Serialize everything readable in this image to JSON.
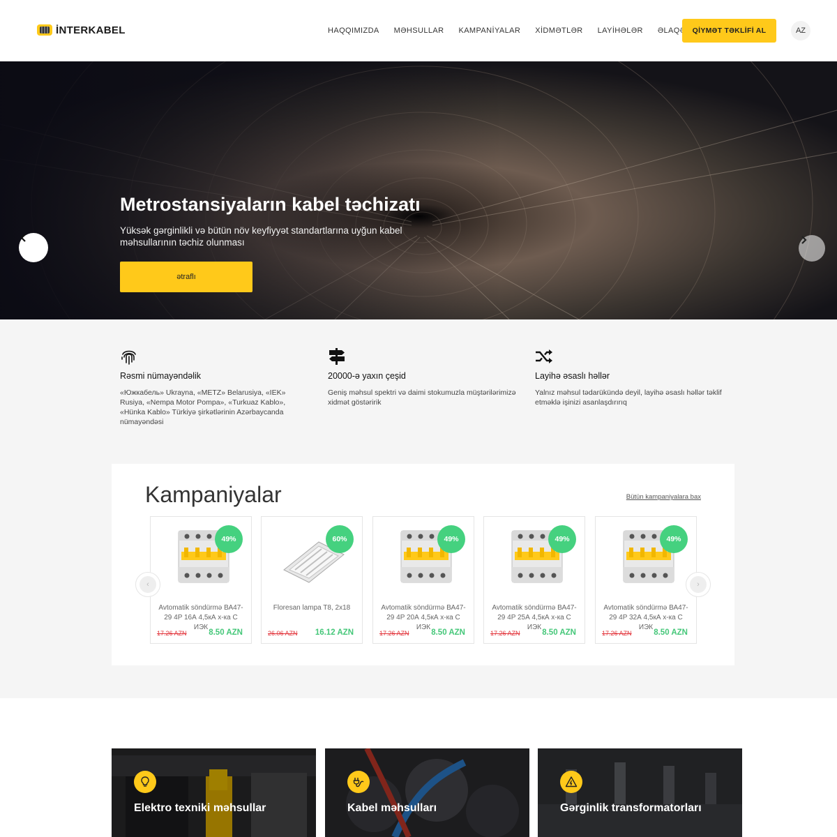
{
  "header": {
    "logo_text": "İNTERKABEL",
    "nav": [
      "HAQQIMIZDA",
      "MƏHSULLAR",
      "KAMPANİYALAR",
      "XİDMƏTLƏR",
      "LAYİHƏLƏR",
      "ƏLAQƏ"
    ],
    "cta": "QİYMƏT TƏKLİFİ AL",
    "lang": "AZ"
  },
  "hero": {
    "title": "Metrostansiyaların kabel təchizatı",
    "subtitle": "Yüksək gərginlikli və bütün növ keyfiyyət standartlarına uyğun kabel məhsullarının təchiz olunması",
    "button": "ətraflı"
  },
  "features": [
    {
      "icon": "fingerprint-icon",
      "title": "Rəsmi nümayəndəlik",
      "text": "«Южкабель» Ukrayna, «METZ» Belarusiya, «IEK» Rusiya, «Nempa Motor Pompa», «Turkuaz Kablo», «Hünka Kablo» Türkiyə şirkətlərinin Azərbaycanda nümayəndəsi"
    },
    {
      "icon": "signpost-icon",
      "title": "20000-ə yaxın çeşid",
      "text": "Geniş məhsul spektri və daimi stokumuzla müştərilərimizə xidmət göstəririk"
    },
    {
      "icon": "shuffle-icon",
      "title": "Layihə əsaslı həllər",
      "text": "Yalnız məhsul tədarükündə deyil, layihə əsaslı həllər təklif etməklə işinizi asanlaşdırırıq"
    }
  ],
  "campaigns": {
    "title": "Kampaniyalar",
    "see_all": "Bütün kampaniyalara bax",
    "items": [
      {
        "badge": "49%",
        "name": "Avtomatik söndürmə ВА47-29 4P 16А 4,5кА х-ка С ИЭК",
        "old_price": "17.26 AZN",
        "new_price": "8.50 AZN",
        "image": "circuit-breaker"
      },
      {
        "badge": "60%",
        "name": "Floresan lampa T8, 2x18",
        "old_price": "26.06 AZN",
        "new_price": "16.12 AZN",
        "image": "fluorescent-lamp"
      },
      {
        "badge": "49%",
        "name": "Avtomatik söndürmə ВА47-29 4P 20А 4,5кА х-ка С ИЭК",
        "old_price": "17.26 AZN",
        "new_price": "8.50 AZN",
        "image": "circuit-breaker"
      },
      {
        "badge": "49%",
        "name": "Avtomatik söndürmə ВА47-29 4P 25А 4,5кА х-ка С ИЭК",
        "old_price": "17.26 AZN",
        "new_price": "8.50 AZN",
        "image": "circuit-breaker"
      },
      {
        "badge": "49%",
        "name": "Avtomatik söndürmə ВА47-29 4P 32А 4,5кА х-ка С ИЭК",
        "old_price": "17.26 AZN",
        "new_price": "8.50 AZN",
        "image": "circuit-breaker"
      }
    ]
  },
  "categories": [
    {
      "icon": "lightbulb-icon",
      "label": "Elektro texniki məhsullar"
    },
    {
      "icon": "plug-icon",
      "label": "Kabel məhsulları"
    },
    {
      "icon": "warning-icon",
      "label": "Gərginlik transformatorları"
    }
  ],
  "colors": {
    "accent": "#ffc91a",
    "badge": "#45d17f",
    "price_new": "#45c779",
    "price_old": "#e2333a"
  }
}
